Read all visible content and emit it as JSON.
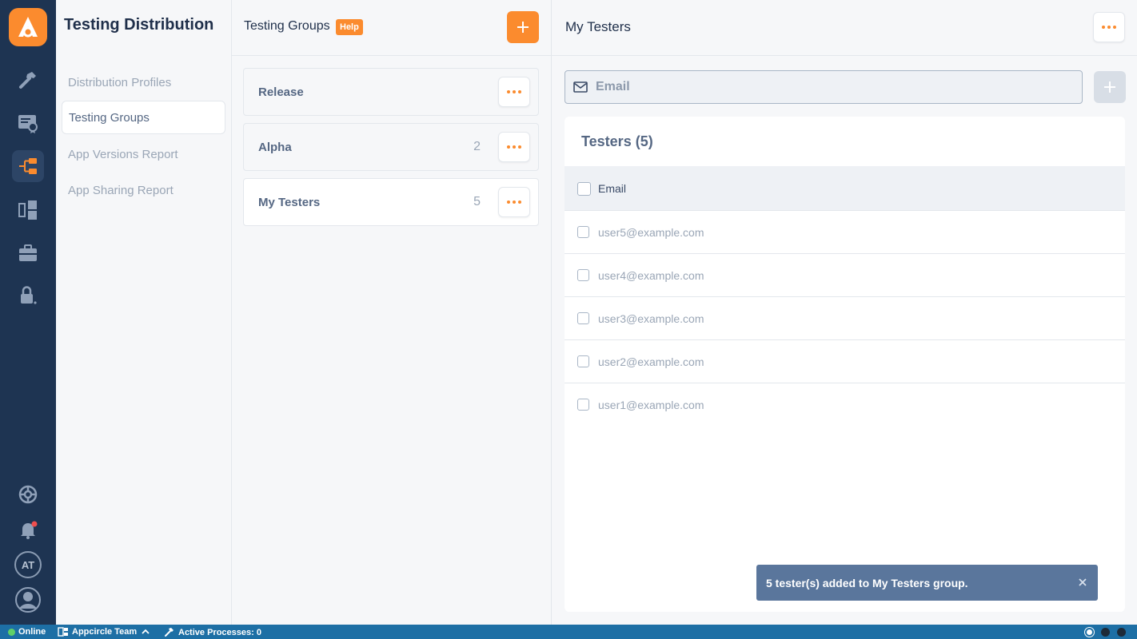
{
  "subnav": {
    "title": "Testing Distribution",
    "items": [
      {
        "label": "Distribution Profiles",
        "active": false
      },
      {
        "label": "Testing Groups",
        "active": true
      },
      {
        "label": "App Versions Report",
        "active": false
      },
      {
        "label": "App Sharing Report",
        "active": false
      }
    ]
  },
  "rail": {
    "icons": [
      "appcircle-logo",
      "hammer-icon",
      "signing-certificate-icon",
      "testing-distribution-icon",
      "store-submit-icon",
      "briefcase-icon",
      "lock-icon",
      "settings-icon",
      "bell-icon",
      "avatar-initials",
      "user-icon"
    ],
    "avatar_initials": "AT",
    "accent": "#fb8b2e",
    "background": "#1e3452"
  },
  "groups": {
    "title": "Testing Groups",
    "help_label": "Help",
    "items": [
      {
        "name": "Release",
        "count": ""
      },
      {
        "name": "Alpha",
        "count": "2"
      },
      {
        "name": "My Testers",
        "count": "5"
      }
    ]
  },
  "main": {
    "title": "My Testers",
    "email_placeholder": "Email",
    "testers_title": "Testers (5)",
    "column_email": "Email",
    "testers": [
      "user5@example.com",
      "user4@example.com",
      "user3@example.com",
      "user2@example.com",
      "user1@example.com"
    ]
  },
  "toast": {
    "message": "5 tester(s) added to My Testers group."
  },
  "status": {
    "online": "Online",
    "team": "Appcircle Team",
    "processes": "Active Processes: 0",
    "color": "#1d6fa5"
  }
}
